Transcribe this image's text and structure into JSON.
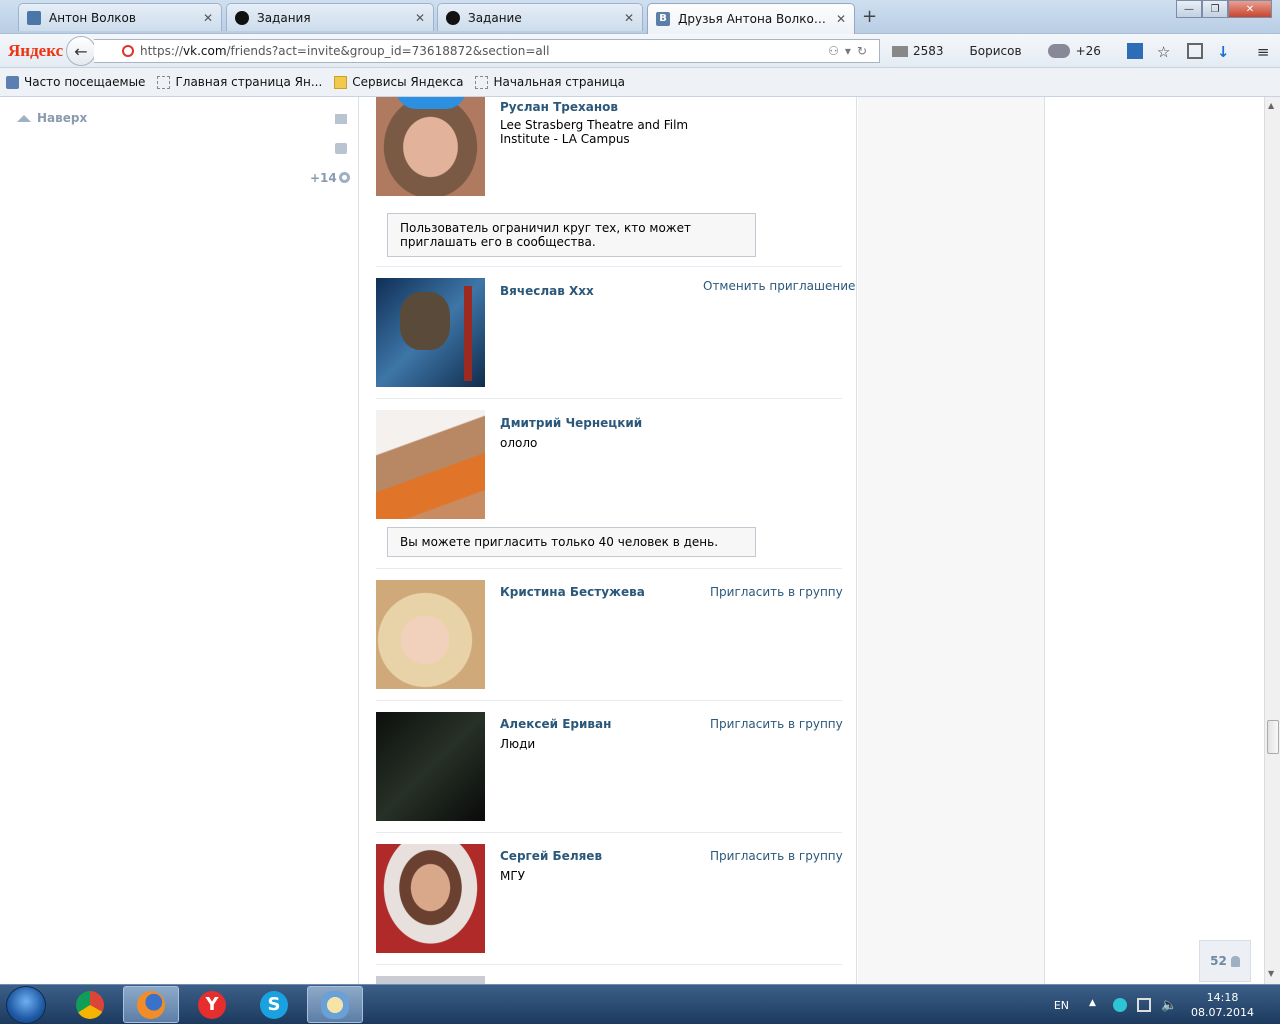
{
  "browser": {
    "tabs": [
      {
        "label": "Антон Волков",
        "icon": "vk-play-icon",
        "active": false
      },
      {
        "label": "Задания",
        "icon": "task-icon",
        "active": false
      },
      {
        "label": "Задание",
        "icon": "task-icon",
        "active": false
      },
      {
        "label": "Друзья Антона Волкова | ...",
        "icon": "vk-icon",
        "active": true
      }
    ],
    "new_tab": "+",
    "logo": "Яндекс",
    "url_host": "vk.com",
    "url_prefix": "https://",
    "url_rest": "/friends?act=invite&group_id=73618872&section=all",
    "mail_count": "2583",
    "city": "Борисов",
    "weather": "+26"
  },
  "bookmarks": [
    {
      "label": "Часто посещаемые"
    },
    {
      "label": "Главная страница Ян..."
    },
    {
      "label": "Сервисы Яндекса"
    },
    {
      "label": "Начальная страница"
    }
  ],
  "sidebar": {
    "naverh": "Наверх",
    "plus": "+14"
  },
  "friends": [
    {
      "name": "Руслан Треханов",
      "sub": "Lee Strasberg Theatre and Film Institute - LA Campus",
      "action": "",
      "notice": "Пользователь ограничил круг тех, кто может приглашать его в сообщества.",
      "avatar_color": "#c79a7c"
    },
    {
      "name": "Вячеслав Ххх",
      "sub": "",
      "action": "Отменить приглашение",
      "notice": "",
      "avatar_color": "#24456a"
    },
    {
      "name": "Дмитрий Чернецкий",
      "sub": "ололо",
      "action": "",
      "notice": "Вы можете пригласить только 40 человек в день.",
      "avatar_color": "#d9a070"
    },
    {
      "name": "Кристина Бестужева",
      "sub": "",
      "action": "Пригласить в группу",
      "notice": "",
      "avatar_color": "#e0c39e"
    },
    {
      "name": "Алексей Ериван",
      "sub": "Люди",
      "action": "Пригласить в группу",
      "notice": "",
      "avatar_color": "#1a1a1a"
    },
    {
      "name": "Сергей Беляев",
      "sub": "МГУ",
      "action": "Пригласить в группу",
      "notice": "",
      "avatar_color": "#8a3a3a"
    }
  ],
  "counter": "52",
  "taskbar": {
    "lang": "EN",
    "time": "14:18",
    "date": "08.07.2014"
  }
}
